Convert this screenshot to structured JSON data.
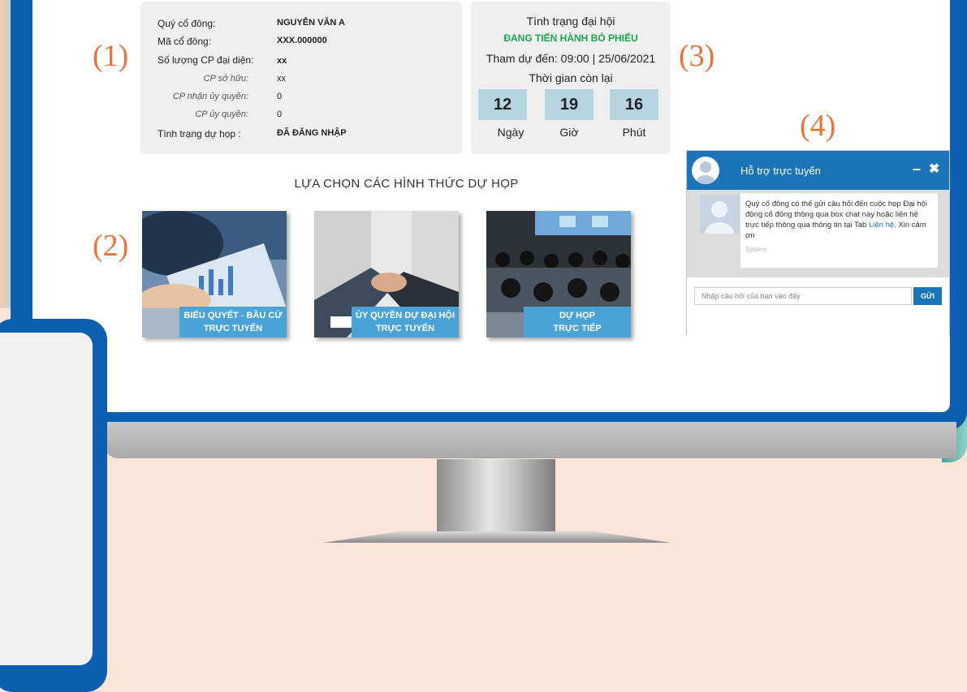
{
  "markers": [
    "(1)",
    "(2)",
    "(3)",
    "(4)"
  ],
  "shareholder": {
    "name_label": "Quý cổ đông:",
    "name_value": "NGUYỄN VĂN A",
    "code_label": "Mã cổ đông:",
    "code_value": "XXX.000000",
    "shares_label": "Số lượng CP đại diện:",
    "shares_value": "xx",
    "owned_label": "CP sở hữu:",
    "owned_value": "xx",
    "received_label": "CP nhận ủy quyền:",
    "received_value": "0",
    "delegated_label": "CP ủy quyền:",
    "delegated_value": "0",
    "attend_label": "Tình trạng dự họp :",
    "attend_value": "ĐÃ ĐĂNG NHẬP"
  },
  "meeting_status": {
    "title": "Tình trạng đại hội",
    "state": "ĐANG TIẾN HÀNH BỎ PHIẾU",
    "attendance": "Tham dự đến: 09:00 | 25/06/2021",
    "remaining_label": "Thời gian còn lại",
    "countdown": [
      {
        "value": "12",
        "unit": "Ngày"
      },
      {
        "value": "19",
        "unit": "Giờ"
      },
      {
        "value": "16",
        "unit": "Phút"
      }
    ]
  },
  "choose": {
    "title": "LỰA CHỌN CÁC HÌNH THỨC DỰ HỌP",
    "options": [
      {
        "line1": "BIỂU QUYẾT - BẦU CỬ",
        "line2": "TRỰC TUYẾN"
      },
      {
        "line1": "ỦY QUYỀN DỰ ĐẠI HỘI",
        "line2": "TRỰC TUYẾN"
      },
      {
        "line1": "DỰ HỌP",
        "line2": "TRỰC TIẾP"
      }
    ]
  },
  "chat": {
    "title": "Hỗ trợ trực tuyến",
    "minimize": "–",
    "close": "✖",
    "message_text": "Quý cổ đông có thể gửi câu hỏi đến cuộc họp Đại hội đồng cổ đông thông qua box chat này hoặc liên hệ trực tiếp thông qua thông tin tại Tab ",
    "message_link": "Liên hệ",
    "message_end": ". Xin cảm ơn",
    "sender": "System",
    "input_placeholder": "Nhập câu hỏi của bạn vào đây",
    "send_label": "GỬI"
  },
  "colors": {
    "accent": "#0b5eb0",
    "status_green": "#1aa64a",
    "caption_blue": "#4aa3d6",
    "marker": "#e8743b"
  }
}
